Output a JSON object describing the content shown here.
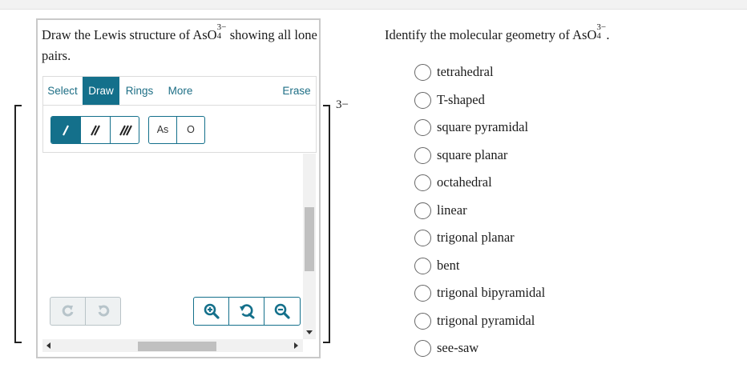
{
  "left_question": {
    "text_before": "Draw the Lewis structure of ",
    "formula_base": "AsO",
    "formula_sup": "3−",
    "formula_sub": "4",
    "text_after": " showing all lone pairs."
  },
  "editor": {
    "tabs": [
      "Select",
      "Draw",
      "Rings",
      "More",
      "Erase"
    ],
    "active_tab": "Draw",
    "bond_tools": [
      "single-bond",
      "double-bond",
      "triple-bond"
    ],
    "active_bond": "single-bond",
    "atoms": [
      "As",
      "O"
    ],
    "ion_charge": "3−"
  },
  "right_question": {
    "text_before": "Identify the molecular geometry of ",
    "formula_base": "AsO",
    "formula_sup": "3−",
    "formula_sub": "4",
    "text_after": "."
  },
  "options": [
    "tetrahedral",
    "T-shaped",
    "square pyramidal",
    "square planar",
    "octahedral",
    "linear",
    "trigonal planar",
    "bent",
    "trigonal bipyramidal",
    "trigonal pyramidal",
    "see-saw"
  ],
  "colors": {
    "accent": "#14708b",
    "link": "#1d6e85",
    "panel_border": "#c9c9c9"
  }
}
